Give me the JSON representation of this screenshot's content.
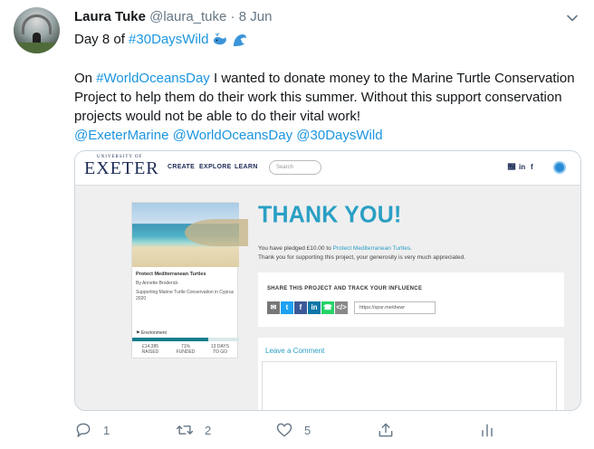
{
  "tweet": {
    "author_name": "Laura Tuke",
    "handle": "@laura_tuke",
    "separator": " · ",
    "date": "8 Jun",
    "line1_prefix": "Day 8 of ",
    "line1_hashtag": "#30DaysWild",
    "text_prefix": "On ",
    "text_hashtag": "#WorldOceansDay",
    "text_body": " I wanted to donate money to the Marine Turtle Conservation Project to help them do their work this summer. Without this support conservation projects would not be able to do their vital work!",
    "mention_1": "@ExeterMarine",
    "mention_2": "@WorldOceansDay",
    "mention_3": "@30DaysWild",
    "emoji_icons": [
      "whale-icon",
      "wave-icon"
    ]
  },
  "embedded": {
    "logo_top": "UNIVERSITY OF",
    "logo_main": "EXETER",
    "nav": [
      "CREATE",
      "EXPLORE",
      "LEARN"
    ],
    "search_placeholder": "Search",
    "social": [
      "twitter-icon",
      "linkedin-icon",
      "facebook-icon"
    ],
    "card": {
      "title": "Protect Mediterranean Turtles",
      "author": "By Annette Broderick",
      "description": "Supporting Marine Turtle Conservation in Cyprus 2020",
      "tag": "Environment",
      "progress_percent": 71,
      "stats": [
        {
          "value": "£14,385",
          "label": "RAISED"
        },
        {
          "value": "71%",
          "label": "FUNDED"
        },
        {
          "value": "13 DAYS",
          "label": "TO GO"
        }
      ]
    },
    "thank_you": "THANK YOU!",
    "pledge_prefix": "You have pledged £10.00 to ",
    "pledge_link": "Protect Mediterranean Turtles",
    "pledge_suffix": ".",
    "support_text": "Thank you for supporting this project, your generosity is very much appreciated.",
    "share_title": "SHARE THIS PROJECT AND TRACK YOUR INFLUENCE",
    "share_url": "https://spsr.me/dwwr",
    "comment_title": "Leave a Comment",
    "colors": {
      "accent": "#2a9fc4",
      "navy": "#1c2a55",
      "progress": "#157d8c"
    }
  },
  "actions": {
    "reply_count": "1",
    "retweet_count": "2",
    "like_count": "5"
  },
  "colors": {
    "link": "#1b95e0",
    "muted": "#657786"
  }
}
